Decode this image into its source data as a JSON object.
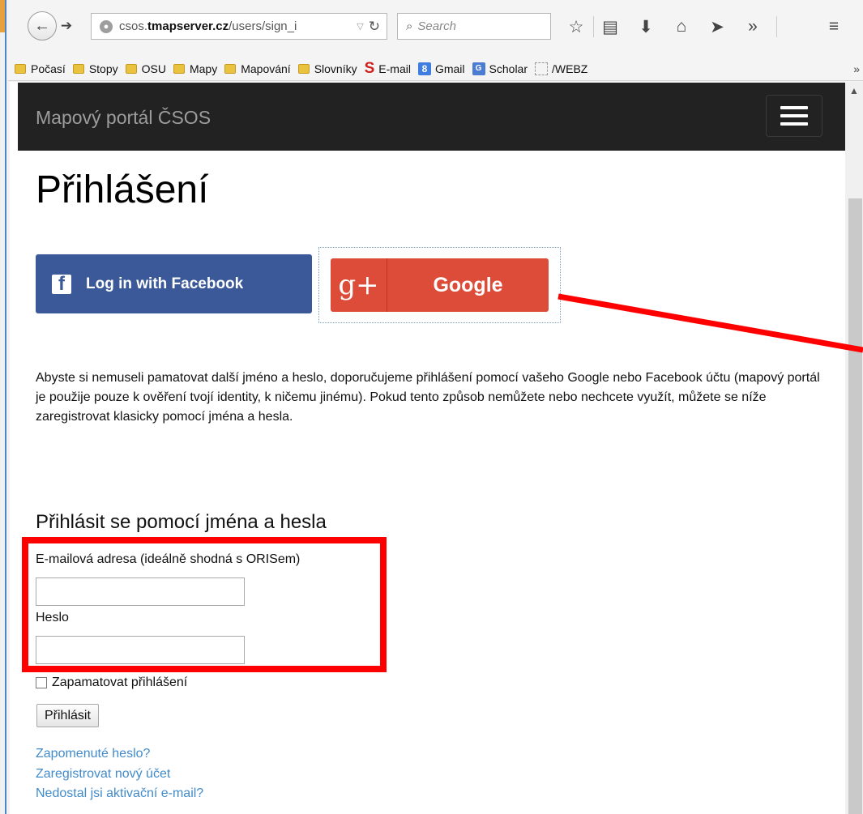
{
  "browser": {
    "url_plain_prefix": "csos.",
    "url_bold": "tmapserver.cz",
    "url_plain_suffix": "/users/sign_i",
    "search_placeholder": "Search",
    "bookmarks": [
      {
        "label": "Počasí",
        "icon": "folder-icon"
      },
      {
        "label": "Stopy",
        "icon": "folder-icon"
      },
      {
        "label": "OSU",
        "icon": "folder-icon"
      },
      {
        "label": "Mapy",
        "icon": "folder-icon"
      },
      {
        "label": "Mapování",
        "icon": "folder-icon"
      },
      {
        "label": "Slovníky",
        "icon": "folder-icon"
      },
      {
        "label": "E-mail",
        "icon": "seznam-s-icon"
      },
      {
        "label": "Gmail",
        "icon": "google-g-icon"
      },
      {
        "label": "Scholar",
        "icon": "scholar-icon"
      },
      {
        "label": "/WEBZ",
        "icon": "blank-page-icon"
      }
    ],
    "bookmarks_overflow": "»"
  },
  "navbar": {
    "brand": "Mapový portál ČSOS"
  },
  "page": {
    "title": "Přihlášení",
    "facebook_button": "Log in with Facebook",
    "google_button": "Google",
    "google_logo": "g+",
    "intro": "Abyste si nemuseli pamatovat další jméno a heslo, doporučujeme přihlášení pomocí vašeho Google nebo Facebook účtu (mapový portál je použije pouze k ověření tvojí identity, k ničemu jinému). Pokud tento způsob nemůžete nebo nechcete využít, můžete se níže zaregistrovat klasicky pomocí jména a hesla.",
    "form": {
      "heading": "Přihlásit se pomocí jména a hesla",
      "email_label": "E-mailová adresa (ideálně shodná s ORISem)",
      "email_value": "",
      "password_label": "Heslo",
      "password_value": "",
      "remember_label": "Zapamatovat přihlášení",
      "remember_checked": false,
      "submit_label": "Přihlásit"
    },
    "links": {
      "forgot_password": "Zapomenuté heslo?",
      "register": "Zaregistrovat nový účet",
      "no_activation": "Nedostal jsi aktivační e-mail?"
    }
  },
  "colors": {
    "facebook": "#3b5998",
    "google": "#dd4b39",
    "navbar": "#222222",
    "link": "#428bca",
    "annotation": "#ff0000"
  }
}
